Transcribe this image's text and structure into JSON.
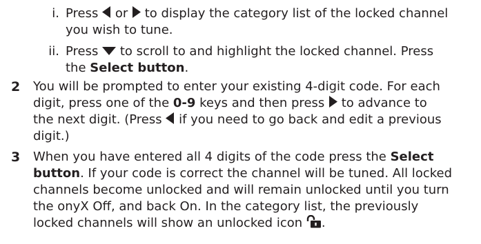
{
  "sub_steps": [
    {
      "numeral": "i.",
      "line1": {
        "pre": "Press ",
        "mid": " or ",
        "post": " to display the category list of the locked channel"
      },
      "line2": "you wish to tune."
    },
    {
      "numeral": "ii.",
      "line1": {
        "pre": "Press ",
        "post": " to scroll to and highlight the locked channel. Press"
      },
      "line2": {
        "pre": "the ",
        "bold": "Select button",
        "post": "."
      }
    }
  ],
  "steps": [
    {
      "number": "2",
      "line1": "You will be prompted to enter your existing 4-digit code. For each",
      "line2": {
        "pre": "digit, press one of the ",
        "bold": "0-9",
        "mid": " keys and then press ",
        "post": " to advance to"
      },
      "line3": {
        "pre": "the next digit. (Press ",
        "post": " if you need to go back and edit a previous"
      },
      "line4": "digit.)"
    },
    {
      "number": "3",
      "line1": {
        "pre": "When you have entered all 4 digits of the code press the ",
        "bold": "Select"
      },
      "line2": {
        "bold": "button",
        "post": ". If your code is correct the channel will be tuned. All locked"
      },
      "line3": "channels become unlocked and will remain unlocked until you turn",
      "line4": "the onyX Off, and back On. In the category list, the previously",
      "line5": {
        "pre": "locked channels will show an unlocked icon ",
        "post": "."
      }
    }
  ],
  "icons": {
    "left_arrow": "left-triangle-icon",
    "right_arrow": "right-triangle-icon",
    "down_arrow": "down-triangle-icon",
    "unlocked": "unlocked-padlock-icon"
  },
  "colors": {
    "text": "#231f20",
    "background": "#ffffff"
  }
}
